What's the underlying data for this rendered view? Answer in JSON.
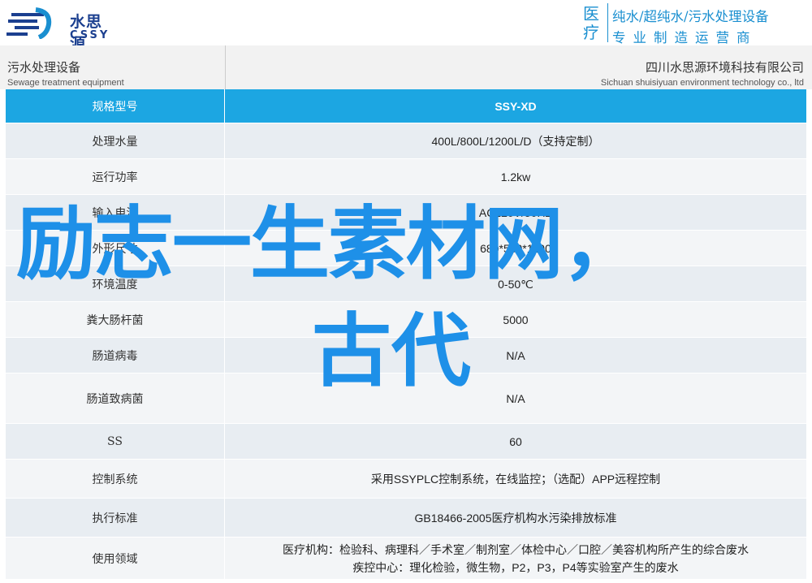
{
  "header": {
    "logo_cn": "水思源",
    "logo_en": "CSSY",
    "side_big": "医疗",
    "tagline_1": "纯水/超纯水/污水处理设备",
    "tagline_2": "专业制造运营商"
  },
  "subheader": {
    "left_cn": "污水处理设备",
    "left_en": "Sewage treatment equipment",
    "right_cn": "四川水思源环境科技有限公司",
    "right_en": "Sichuan shuisiyuan environment technology co., ltd"
  },
  "table": {
    "rows": [
      {
        "label": "规格型号",
        "value": [
          "SSY-XD"
        ]
      },
      {
        "label": "处理水量",
        "value": [
          "400L/800L/1200L/D（支持定制）"
        ]
      },
      {
        "label": "运行功率",
        "value": [
          "1.2kw"
        ]
      },
      {
        "label": "输入电源",
        "value": [
          "AC220V/50HZ"
        ]
      },
      {
        "label": "外形尺寸",
        "value": [
          "680*560*1100"
        ]
      },
      {
        "label": "环境温度",
        "value": [
          "0-50℃"
        ]
      },
      {
        "label": "粪大肠杆菌",
        "value": [
          "5000"
        ]
      },
      {
        "label": "肠道病毒",
        "value": [
          "N/A"
        ]
      },
      {
        "label": "肠道致病菌",
        "value": [
          "N/A"
        ]
      },
      {
        "label": "SS",
        "value": [
          "60"
        ]
      },
      {
        "label": "控制系统",
        "value": [
          "采用SSYPLC控制系统，在线监控；（选配）APP远程控制"
        ]
      },
      {
        "label": "执行标准",
        "value": [
          "GB18466-2005医疗机构水污染排放标准"
        ]
      },
      {
        "label": "使用领域",
        "value": [
          "医疗机构：检验科、病理科／手术室／制剂室／体检中心／口腔／美容机构所产生的综合废水",
          "疾控中心：理化检验，微生物，P2，P3，P4等实验室产生的废水"
        ]
      }
    ]
  },
  "watermark": {
    "line1": "励志一生素材网，",
    "line2": "古代"
  },
  "colors": {
    "brand_blue": "#1b3f8f",
    "accent_blue": "#1a8fd0",
    "table_header": "#1ca6e2",
    "watermark": "#1e90e8"
  }
}
